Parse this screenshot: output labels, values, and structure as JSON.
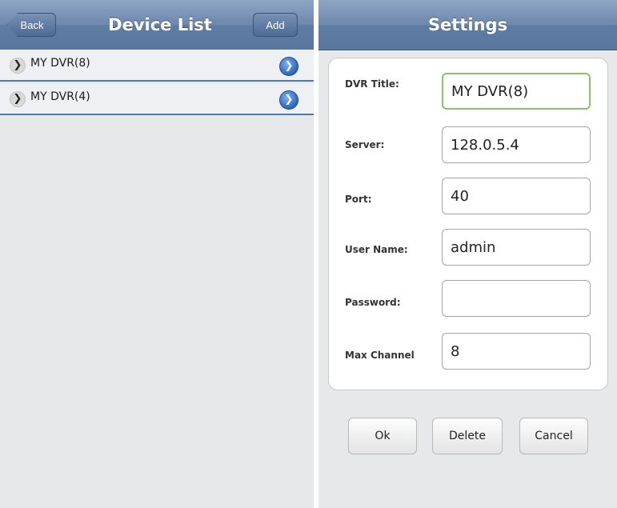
{
  "device_list": {
    "title": "Device List",
    "back_label": "Back",
    "add_label": "Add",
    "devices": [
      {
        "name": "MY DVR(8)"
      },
      {
        "name": "MY DVR(4)"
      }
    ]
  },
  "settings": {
    "title": "Settings",
    "fields": {
      "dvr_title": {
        "label": "DVR Title:",
        "value": "MY DVR(8)"
      },
      "server": {
        "label": "Server:",
        "value": "128.0.5.4"
      },
      "port": {
        "label": "Port:",
        "value": "40"
      },
      "user_name": {
        "label": "User Name:",
        "value": "admin"
      },
      "password": {
        "label": "Password:",
        "value": ""
      },
      "max_channel": {
        "label": "Max Channel",
        "value": "8"
      }
    },
    "buttons": {
      "ok": "Ok",
      "delete": "Delete",
      "cancel": "Cancel"
    }
  },
  "icons": {
    "expand": "chevron-right-icon",
    "detail": "info-arrow-icon"
  },
  "colors": {
    "header_top": "#8fa6c5",
    "header_bottom": "#58769e",
    "focus_border": "#8cc36a",
    "row_divider": "#4f7aa6"
  }
}
